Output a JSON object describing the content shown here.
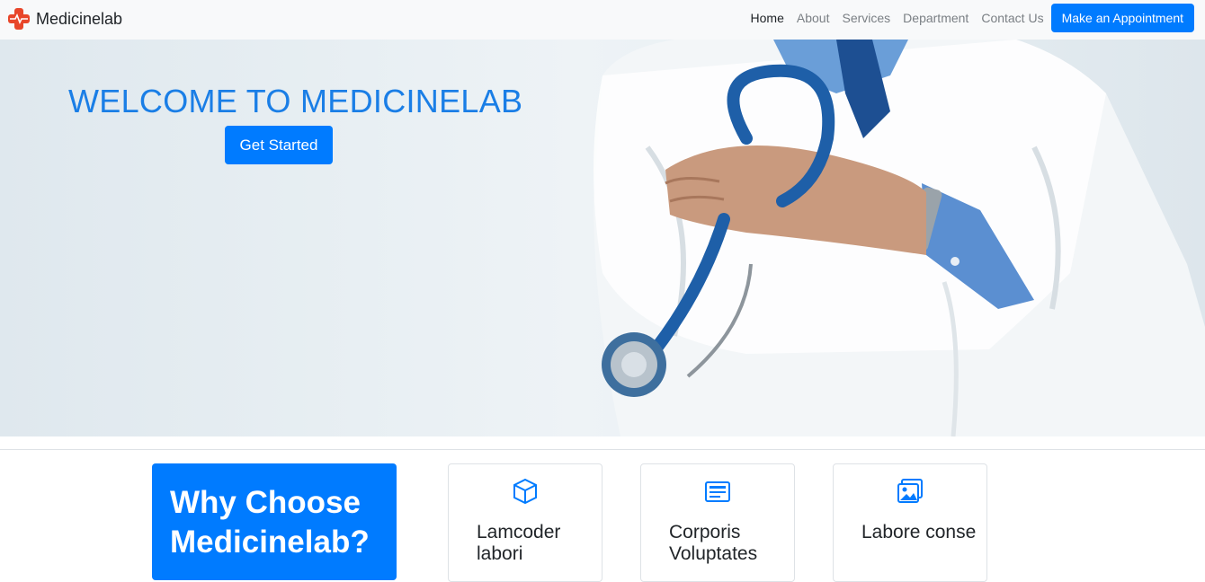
{
  "brand": {
    "name": "Medicinelab",
    "logo": "medical-cross-icon",
    "logo_color": "#e8462a"
  },
  "nav": {
    "links": [
      {
        "label": "Home",
        "active": true
      },
      {
        "label": "About"
      },
      {
        "label": "Services"
      },
      {
        "label": "Department"
      },
      {
        "label": "Contact Us"
      }
    ],
    "cta": "Make an Appointment"
  },
  "hero": {
    "title": "WELCOME TO MEDICINELAB",
    "button": "Get Started"
  },
  "features": {
    "why_title": "Why Choose Medicinelab?",
    "cards": [
      {
        "icon": "box-icon",
        "title": "Lamcoder labori"
      },
      {
        "icon": "document-icon",
        "title": "Corporis Voluptates"
      },
      {
        "icon": "images-icon",
        "title": "Labore conse"
      }
    ]
  },
  "colors": {
    "primary": "#007bff",
    "title_blue": "#1a7ee6",
    "navbar_bg": "#f8f9fa"
  }
}
